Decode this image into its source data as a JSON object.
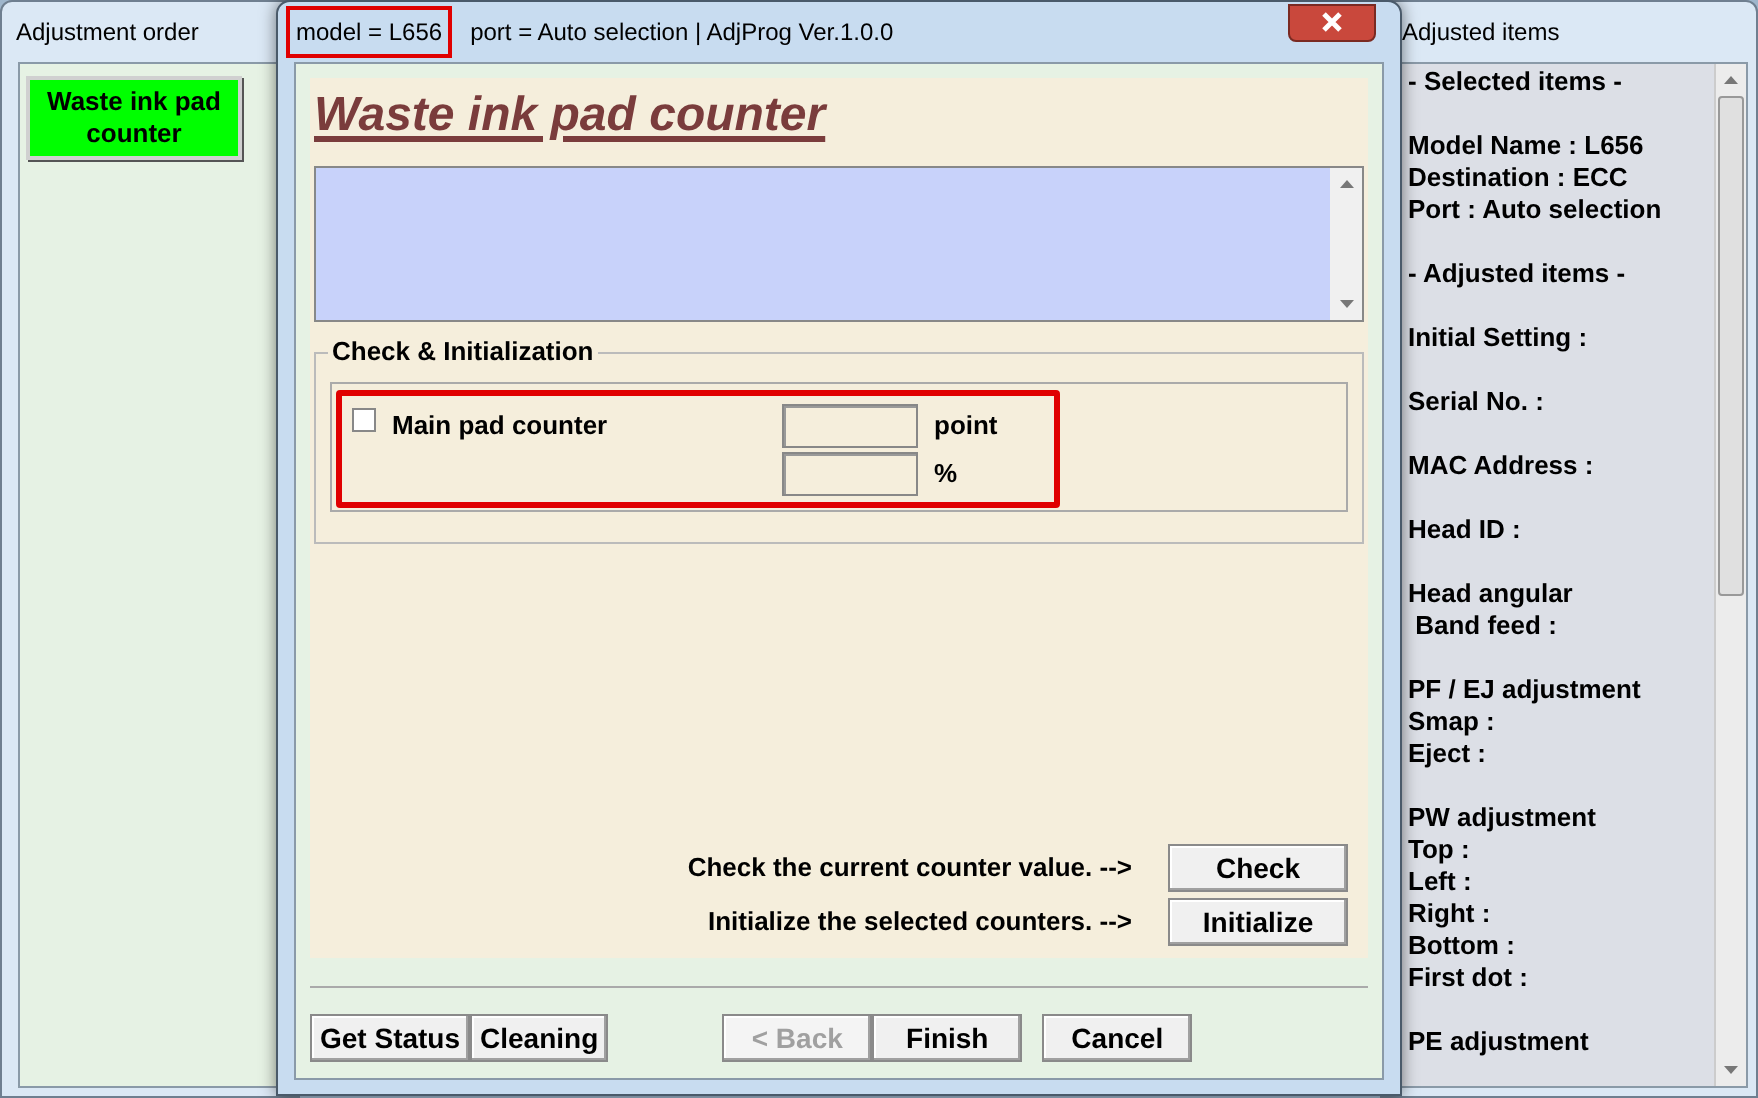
{
  "left_window": {
    "title": "Adjustment order",
    "items": [
      {
        "label": "Waste ink pad counter",
        "selected": true
      }
    ]
  },
  "dialog": {
    "title_parts": [
      {
        "text": "model = L656",
        "highlighted": true
      },
      {
        "text": "port = Auto selection | AdjProg Ver.1.0.0",
        "highlighted": false
      }
    ],
    "heading": "Waste ink pad counter",
    "group": {
      "title": "Check & Initialization",
      "counters": [
        {
          "label": "Main pad counter",
          "checked": false,
          "fields": [
            {
              "unit": "point"
            },
            {
              "unit": "%"
            }
          ]
        }
      ]
    },
    "actions": [
      {
        "text": "Check the current counter value. -->",
        "button": "Check"
      },
      {
        "text": "Initialize the selected counters. -->",
        "button": "Initialize"
      }
    ],
    "left_buttons": [
      {
        "label": "Get Status",
        "disabled": false
      },
      {
        "label": "Cleaning",
        "disabled": false
      }
    ],
    "nav_buttons": [
      {
        "label": "< Back",
        "disabled": true
      },
      {
        "label": "Finish",
        "disabled": false
      },
      {
        "label": "Cancel",
        "disabled": false
      }
    ]
  },
  "right_window": {
    "title": "Adjusted items",
    "groups": [
      [
        "- Selected items -"
      ],
      [
        "Model Name : L656",
        "Destination : ECC",
        "Port : Auto selection"
      ],
      [
        "- Adjusted items -"
      ],
      [
        "Initial Setting :"
      ],
      [
        "Serial No. :"
      ],
      [
        "MAC Address :"
      ],
      [
        "Head ID :"
      ],
      [
        "Head angular",
        " Band feed :"
      ],
      [
        "PF / EJ adjustment",
        "Smap :",
        "Eject :"
      ],
      [
        "PW adjustment",
        "Top :",
        "Left :",
        "Right :",
        "Bottom :",
        "First dot :"
      ],
      [
        "PE adjustment"
      ]
    ]
  }
}
